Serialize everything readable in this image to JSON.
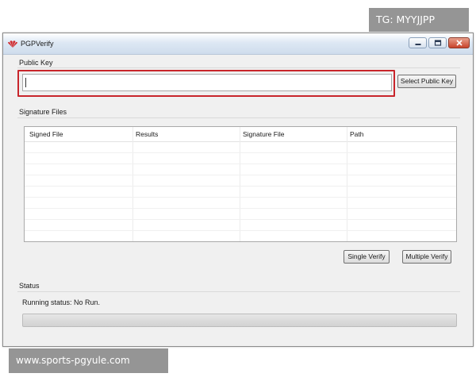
{
  "window": {
    "title": "PGPVerify"
  },
  "public_key": {
    "label": "Public Key",
    "value": "",
    "select_button": "Select Public Key"
  },
  "signature_files": {
    "label": "Signature Files",
    "columns": [
      "Signed File",
      "Results",
      "Signature File",
      "Path"
    ],
    "rows": []
  },
  "actions": {
    "single_verify": "Single Verify",
    "multiple_verify": "Multiple Verify"
  },
  "status": {
    "label": "Status",
    "running_status": "Running status: No Run.",
    "progress": 0
  },
  "overlays": {
    "tg_text": "TG: MYYJJPP",
    "site_text": "www.sports-pgyule.com"
  },
  "colors": {
    "highlight": "#c8252b",
    "title_bar": "#dde8f4",
    "window_bg": "#f0f0f0"
  }
}
